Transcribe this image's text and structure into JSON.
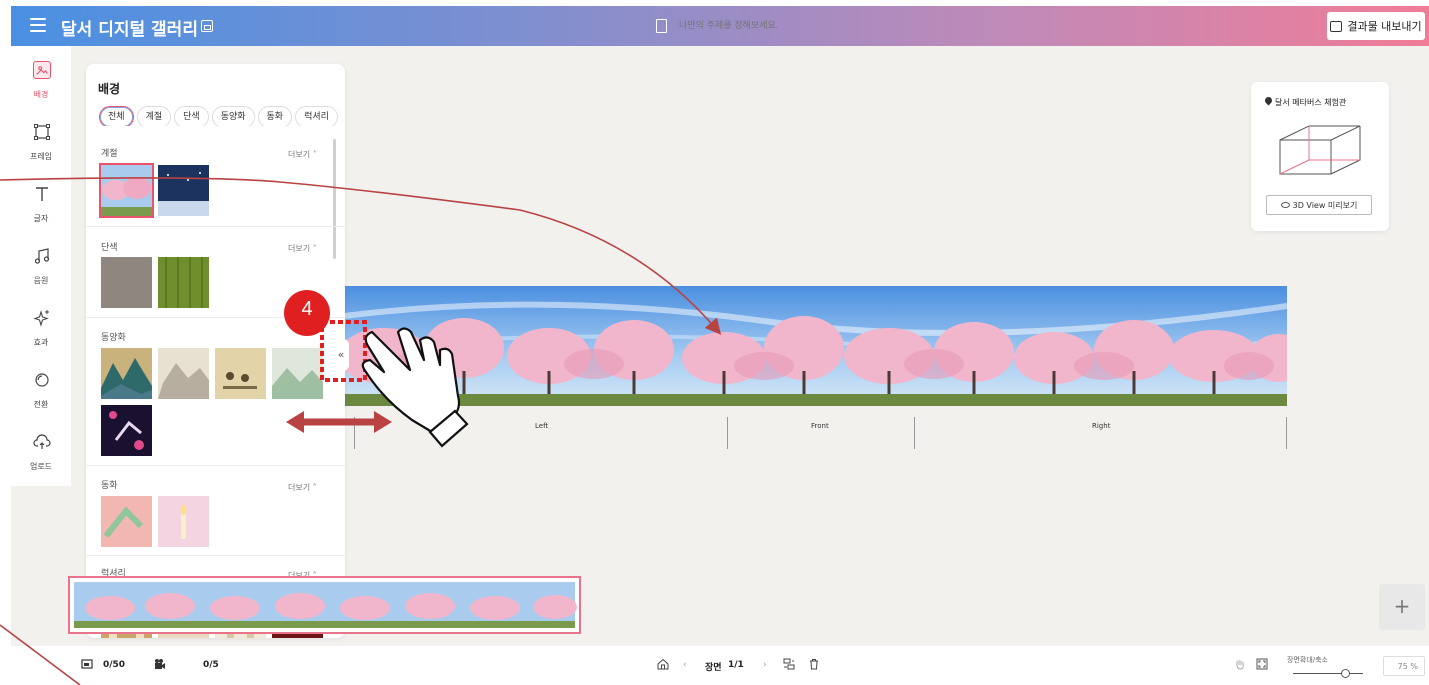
{
  "topbar": {
    "title": "달서 디지털 갤러리",
    "topic_placeholder": "나만의 주제를 정해보세요.",
    "export_label": "결과물 내보내기"
  },
  "sidebar": {
    "items": [
      {
        "label": "배경",
        "icon": "image-icon",
        "active": true
      },
      {
        "label": "프레임",
        "icon": "frame-icon"
      },
      {
        "label": "글자",
        "icon": "text-icon"
      },
      {
        "label": "음원",
        "icon": "music-icon"
      },
      {
        "label": "효과",
        "icon": "sparkle-icon"
      },
      {
        "label": "전환",
        "icon": "transition-icon"
      },
      {
        "label": "업로드",
        "icon": "upload-cloud-icon"
      }
    ]
  },
  "panel": {
    "title": "배경",
    "chips": [
      "전체",
      "계절",
      "단색",
      "동양화",
      "동화",
      "럭셔리"
    ],
    "active_chip": "전체",
    "more_label": "더보기 ˄",
    "sections": [
      {
        "title": "계절"
      },
      {
        "title": "단색"
      },
      {
        "title": "동양화"
      },
      {
        "title": "동화"
      },
      {
        "title": "럭셔리"
      }
    ]
  },
  "collapse_label": "«",
  "walls": [
    "Left",
    "Front",
    "Right"
  ],
  "preview": {
    "venue": "달서 메타버스 체험관",
    "button": "3D View 미리보기"
  },
  "add_label": "+",
  "bottombar": {
    "image_count": "0/50",
    "video_count": "0/5",
    "scene_label": "장면",
    "scene_value": "1/1",
    "zoom_label": "장면확대/축소",
    "zoom_value": "75 %"
  },
  "annotation": {
    "step": "4",
    "colors": {
      "accent": "#e9536b",
      "step_circle": "#e02020",
      "arrow": "#b94242",
      "dashed": "#e02020"
    }
  }
}
